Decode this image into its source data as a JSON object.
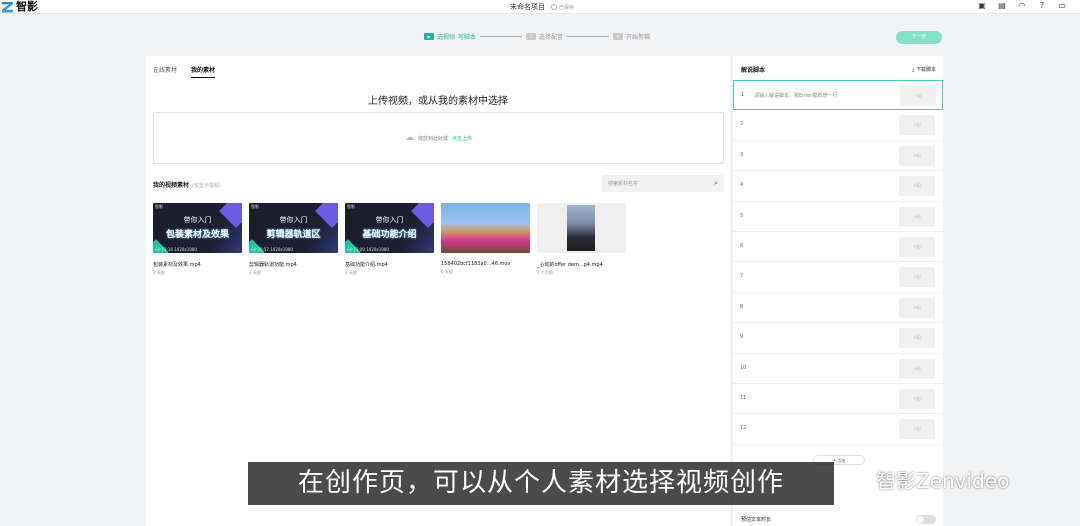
{
  "app": {
    "name": "智影",
    "project_title": "未命名项目",
    "saved_label": "已保存"
  },
  "steps": [
    {
      "label": "选视频",
      "sub": "写脚本",
      "active": true
    },
    {
      "label": "选择配音",
      "active": false
    },
    {
      "label": "开始剪辑",
      "active": false
    }
  ],
  "next_label": "下一步",
  "tabs": [
    "在线素材",
    "我的素材"
  ],
  "upload": {
    "title": "上传视频，或从我的素材中选择",
    "drop_text": "拖放到此处或",
    "drop_link": "点击上传"
  },
  "my_materials": {
    "title": "我的视频素材",
    "note": "(仅显示视频)",
    "search_placeholder": "搜索素材名字"
  },
  "videos": [
    {
      "name": "包装素材及效果.mp4",
      "time": "3 天前",
      "line1": "带你入门",
      "line2": "包装素材及效果",
      "meta": "00:01:16 1920x1080",
      "corner": "智影"
    },
    {
      "name": "剪辑器轨道功能.mp4",
      "time": "3 天前",
      "line1": "带你入门",
      "line2": "剪辑器轨道区",
      "meta": "00:00:57 1920x1080",
      "corner": "智影"
    },
    {
      "name": "基础功能介绍.mp4",
      "time": "3 天前",
      "line1": "带你入门",
      "line2": "基础功能介绍",
      "meta": "00:01:09 1920x1080",
      "corner": "智影"
    },
    {
      "name": "158402bcf1183a0...46.mov",
      "time": "6 天前"
    },
    {
      "name": "_心动的offer dem...p4.mp4",
      "time": "1 个月前"
    }
  ],
  "script_panel": {
    "title": "解说脚本",
    "download_label": "下载脚本",
    "placeholder": "请输入解说脚本，按Enter键新增一行",
    "rows": [
      "1",
      "2",
      "3",
      "4",
      "5",
      "6",
      "7",
      "8",
      "9",
      "10",
      "11",
      "12"
    ],
    "row_button": "+配",
    "add_label": "+ 添加",
    "estimate_label": "预估文本时长"
  },
  "overlay": {
    "subtitle": "在创作页，可以从个人素材选择视频创作",
    "watermark": "智影Zenvideo"
  },
  "colors": {
    "accent": "#1cb5a5",
    "next_button": "#85dfc9"
  }
}
